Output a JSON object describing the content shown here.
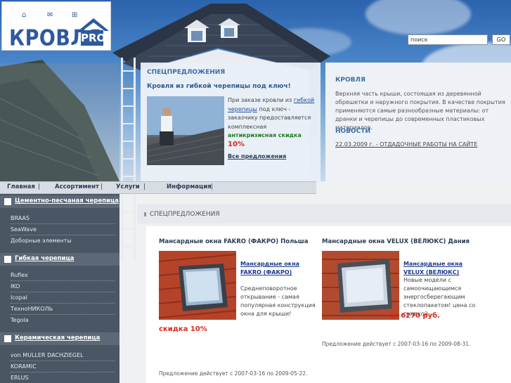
{
  "header": {
    "logo_word": "КРОВЛЯ",
    "logo_pro": "PRO",
    "search_placeholder": "поиск",
    "go_label": "GO"
  },
  "top_special": {
    "title": "СПЕЦПРЕДЛОЖЕНИЯ",
    "subtitle": "Кровля из гибкой черепицы под ключ!",
    "text_before": "При заказе кровли из ",
    "link": "гибкой черепицы",
    "text_after": " под ключ - заказчику предоставляется комплексная",
    "green_text": "антикризисная скидка",
    "discount": "10%",
    "all_offers": "Все предложения"
  },
  "right_panel": {
    "krovlya_title": "КРОВЛЯ",
    "krovlya_text": "Верхняя часть крыши, состоящая из деревянной обрешетки и наружного покрытия. В качестве покрытия применяются самые разнообразные материалы: от дранки и черепицы до современных пластиковых материалов.",
    "news_title": "НОВОСТИ",
    "news_item": "22.03.2009 г. - ОТДАДОЧНЫЕ РАБОТЫ НА САЙТЕ"
  },
  "nav": {
    "items": [
      "Главная",
      "Ассортимент",
      "Услуги",
      "Информация"
    ],
    "sep": "|"
  },
  "sidebar": {
    "categories": [
      {
        "label": "Цементно-песчаная черепица",
        "items": [
          "BRAAS",
          "SeaWave",
          "Доборные элементы"
        ]
      },
      {
        "label": "Гибкая черепица",
        "items": [
          "Ruflex",
          "IKO",
          "Icopal",
          "ТехноНИКОЛЬ",
          "Tegola"
        ]
      },
      {
        "label": "Керамическая черепица",
        "items": [
          "von MULLER DACHZIEGEL",
          "KORAMIC",
          "ERLUS"
        ]
      }
    ]
  },
  "main": {
    "title": "СПЕЦПРЕДЛОЖЕНИЯ",
    "offers": [
      {
        "title": "Мансардные окна FAKRO (ФАКРО) Польша",
        "link": "Мансардные окна FAKRO (ФАКРО)",
        "desc": "Среднеповоротное открывание - самая популярная конструкция окна для крыши!",
        "price": "скидка 10%",
        "valid": "Предложение действует с 2007-03-16 по 2009-05-22."
      },
      {
        "title": "Мансардные окна VELUX (ВЕЛЮКС) Дания",
        "link": "Мансардные окна VELUX (ВЕЛЮКС)",
        "desc": "Новые модели с самоочищающимся энергосберегающим стеклопакетом! цена со скидкой -",
        "price": "от 6270 руб.",
        "valid": "Предложение действует с 2007-03-16 по 2009-08-31."
      }
    ]
  }
}
